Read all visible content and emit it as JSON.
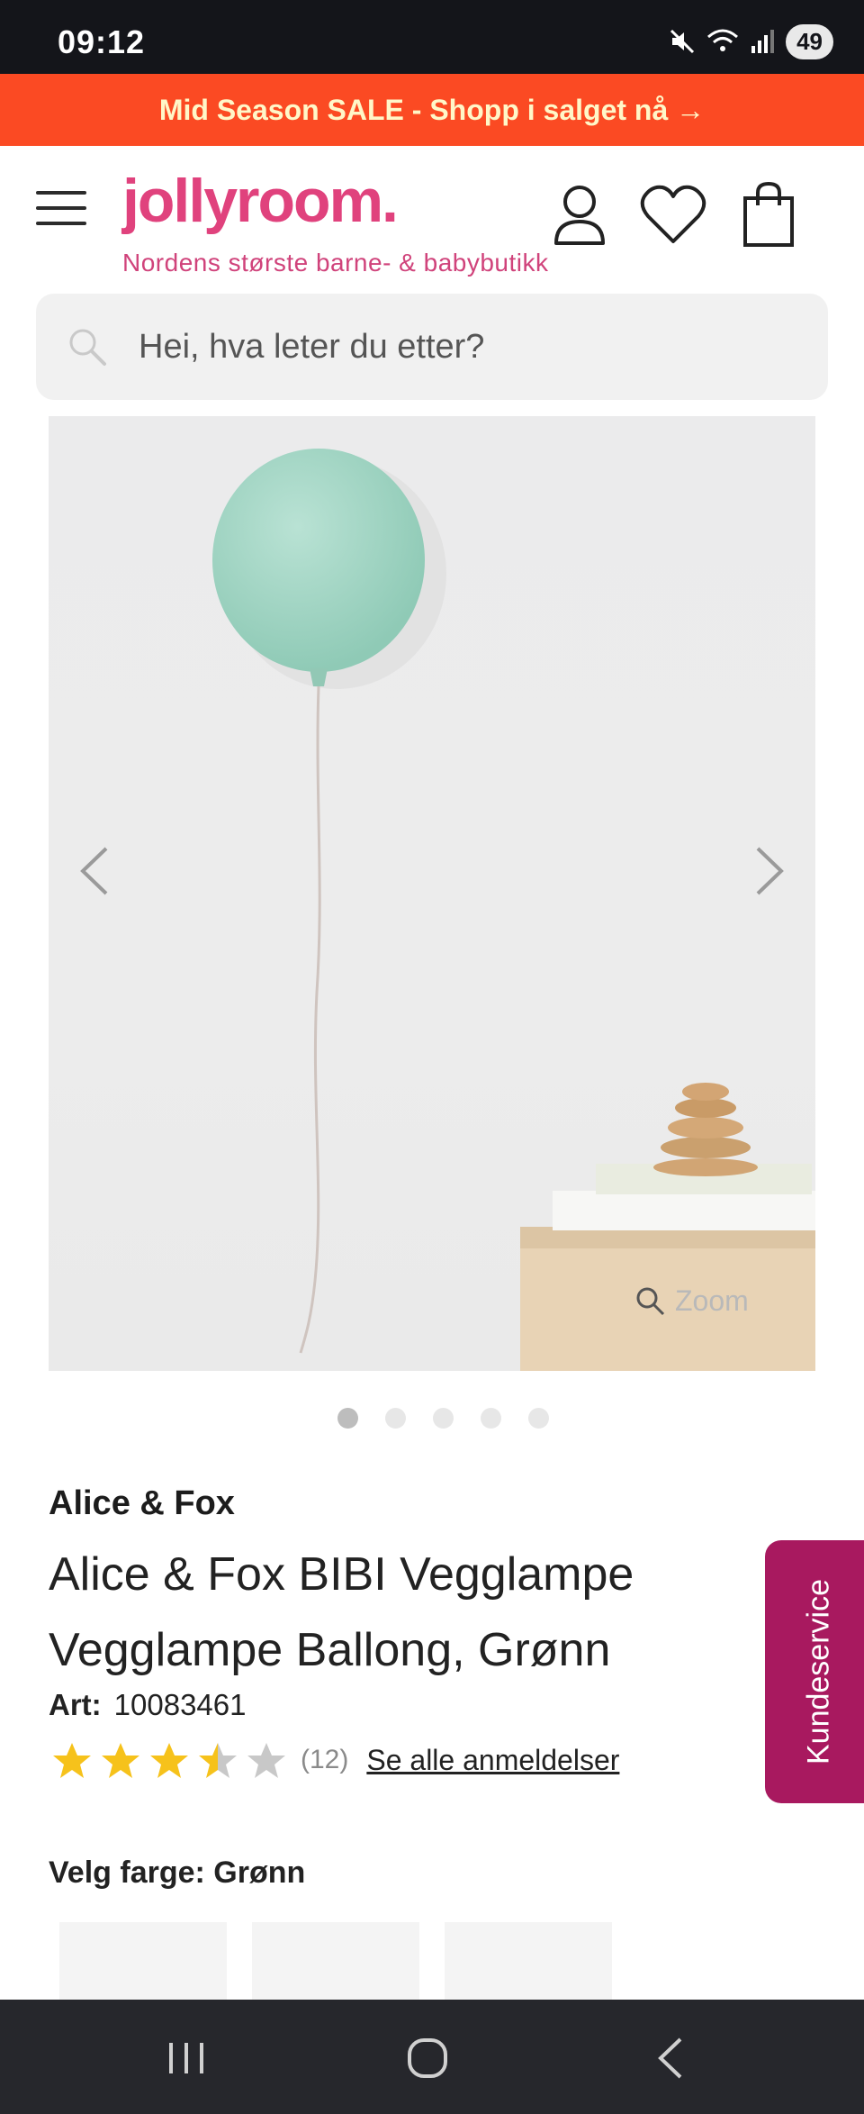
{
  "status_bar": {
    "time": "09:12",
    "battery": "49"
  },
  "promo": {
    "text": "Mid Season SALE - Shopp i salget nå →"
  },
  "header": {
    "logo": "jollyroom.",
    "tagline": "Nordens største barne- & babybutikk"
  },
  "search": {
    "placeholder": "Hei, hva leter du etter?"
  },
  "gallery": {
    "zoom_label": "Zoom",
    "image_count": 5,
    "active_index": 0
  },
  "product": {
    "brand": "Alice & Fox",
    "title": "Alice & Fox BIBI Vegglampe Vegglampe Ballong, Grønn",
    "art_label": "Art:",
    "art_number": "10083461",
    "rating": 3.5,
    "rating_max": 5,
    "review_count": "(12)",
    "reviews_link": "Se alle anmeldelser"
  },
  "color_chooser": {
    "label": "Velg farge: Grønn",
    "swatches": [
      {
        "color": "#a9cfc0"
      },
      {
        "color": "#8f9499"
      },
      {
        "color": "#a7abb0"
      }
    ]
  },
  "customer_service": {
    "label": "Kundeservice"
  },
  "colors": {
    "promo_bg": "#fb4a23",
    "brand_pink": "#e0427d",
    "kundeservice_bg": "#a8195f",
    "star_gold": "#f6c21b",
    "star_grey": "#c8c8c8"
  }
}
